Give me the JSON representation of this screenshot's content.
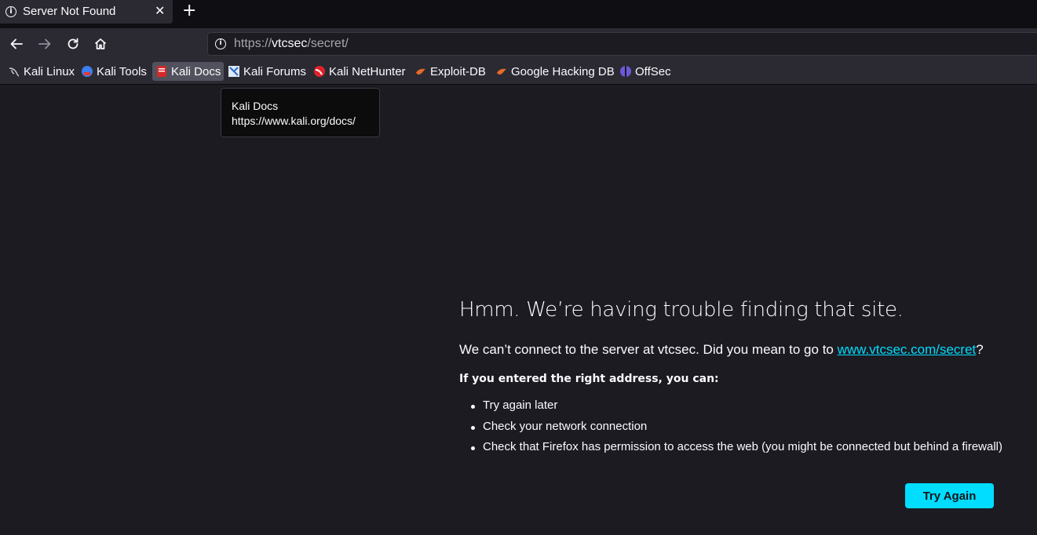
{
  "tab": {
    "title": "Server Not Found",
    "close": "✕",
    "new_tab": "+"
  },
  "navbar": {
    "url_host": "vtcsec",
    "url_prefix": "https://",
    "url_path": "/secret/"
  },
  "bookmarks": [
    {
      "label": "Kali Linux",
      "icon": "kali-dragon-icon",
      "color": "#cfcfd8"
    },
    {
      "label": "Kali Tools",
      "icon": "kali-tools-icon",
      "color": "#3d7ef0"
    },
    {
      "label": "Kali Docs",
      "icon": "kali-docs-icon",
      "color": "#d32a2a"
    },
    {
      "label": "Kali Forums",
      "icon": "kali-forums-icon",
      "color": "#4a89d8"
    },
    {
      "label": "Kali NetHunter",
      "icon": "kali-nethunter-icon",
      "color": "#e0222a"
    },
    {
      "label": "Exploit-DB",
      "icon": "exploit-db-icon",
      "color": "#e86a2a"
    },
    {
      "label": "Google Hacking DB",
      "icon": "ghdb-icon",
      "color": "#e86a2a"
    },
    {
      "label": "OffSec",
      "icon": "offsec-icon",
      "color": "#6a5ad8"
    }
  ],
  "tooltip": {
    "title": "Kali Docs",
    "url": "https://www.kali.org/docs/"
  },
  "error": {
    "title": "Hmm. We’re having trouble finding that site.",
    "message_before": "We can’t connect to the server at vtcsec. Did you mean to go to ",
    "suggestion_link": "www.vtcsec.com/secret",
    "message_after": "?",
    "subtitle": "If you entered the right address, you can:",
    "suggestions": [
      "Try again later",
      "Check your network connection",
      "Check that Firefox has permission to access the web (you might be connected but behind a firewall)"
    ],
    "button": "Try Again"
  }
}
